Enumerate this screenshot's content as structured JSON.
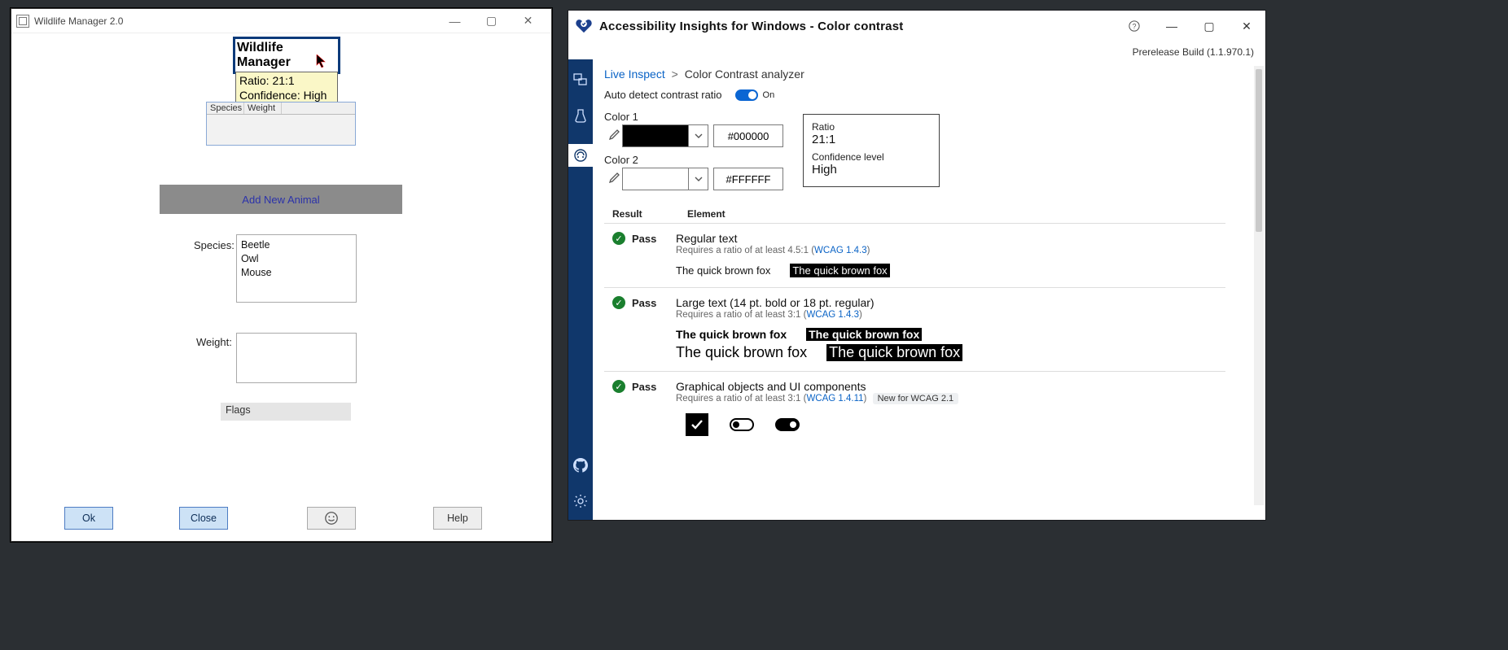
{
  "wm": {
    "title": "Wildlife Manager 2.0",
    "heading": "Wildlife Manager",
    "tooltip_line1": "Ratio: 21:1",
    "tooltip_line2": "Confidence: High",
    "grid_headers": [
      "Species",
      "Weight"
    ],
    "add_button": "Add New Animal",
    "species_label": "Species:",
    "species_options": [
      "Beetle",
      "Owl",
      "Mouse"
    ],
    "weight_label": "Weight:",
    "flags_label": "Flags",
    "buttons": {
      "ok": "Ok",
      "close": "Close",
      "help": "Help"
    }
  },
  "ai": {
    "title": "Accessibility Insights for Windows - Color contrast",
    "prerelease": "Prerelease Build (1.1.970.1)",
    "breadcrumb": {
      "link": "Live Inspect",
      "current": "Color Contrast analyzer",
      "sep": ">"
    },
    "autodetect_label": "Auto detect contrast ratio",
    "autodetect_state": "On",
    "color1_label": "Color 1",
    "color1_hex": "#000000",
    "color2_label": "Color 2",
    "color2_hex": "#FFFFFF",
    "ratio_card": {
      "ratio_label": "Ratio",
      "ratio_value": "21:1",
      "conf_label": "Confidence level",
      "conf_value": "High"
    },
    "results_header": {
      "result": "Result",
      "element": "Element"
    },
    "pass_label": "Pass",
    "results": [
      {
        "title": "Regular text",
        "sub_prefix": "Requires a ratio of at least 4.5:1 (",
        "sub_link": "WCAG 1.4.3",
        "sub_suffix": ")",
        "sample": "The quick brown fox"
      },
      {
        "title": "Large text (14 pt. bold or 18 pt. regular)",
        "sub_prefix": "Requires a ratio of at least 3:1 (",
        "sub_link": "WCAG 1.4.3",
        "sub_suffix": ")",
        "sample": "The quick brown fox"
      },
      {
        "title": "Graphical objects and UI components",
        "sub_prefix": "Requires a ratio of at least 3:1 (",
        "sub_link": "WCAG 1.4.11",
        "sub_suffix": ")",
        "badge": "New for WCAG 2.1"
      }
    ]
  }
}
